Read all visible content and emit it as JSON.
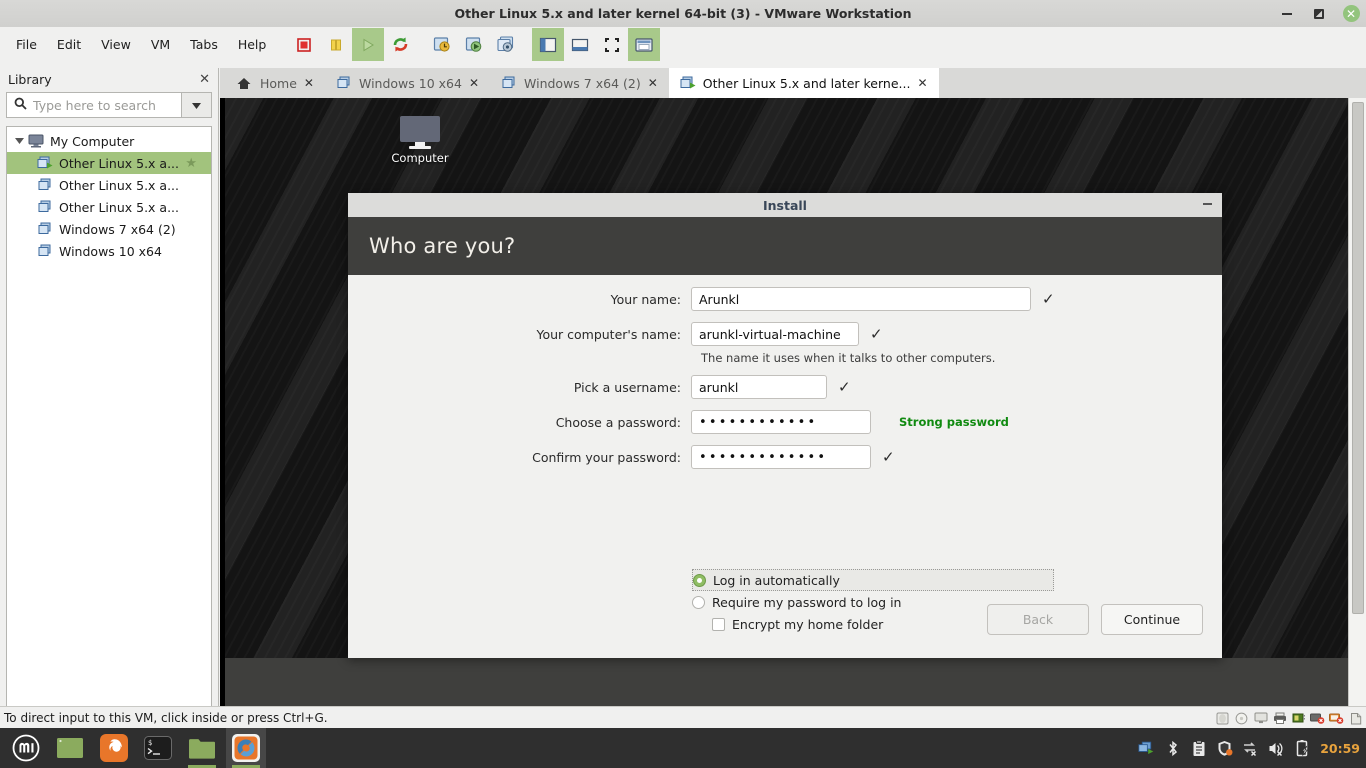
{
  "window": {
    "title": "Other Linux 5.x and later kernel 64-bit (3) - VMware Workstation",
    "minimize_icon": "minimize-icon",
    "maximize_icon": "restore-icon",
    "close_icon": "close-icon"
  },
  "menubar": {
    "items": [
      {
        "label": "File"
      },
      {
        "label": "Edit"
      },
      {
        "label": "View"
      },
      {
        "label": "VM"
      },
      {
        "label": "Tabs"
      },
      {
        "label": "Help"
      }
    ]
  },
  "toolbar": {
    "buttons": [
      {
        "name": "power-off-icon",
        "title": "Power Off"
      },
      {
        "name": "suspend-icon",
        "title": "Suspend"
      },
      {
        "name": "power-on-icon",
        "title": "Power On",
        "active": true
      },
      {
        "name": "restart-guest-icon",
        "title": "Restart Guest"
      },
      {
        "name": "snapshot-take-icon",
        "title": "Take Snapshot"
      },
      {
        "name": "snapshot-revert-icon",
        "title": "Revert Snapshot"
      },
      {
        "name": "snapshot-manager-icon",
        "title": "Manage Snapshots"
      },
      {
        "name": "show-library-icon",
        "title": "Show or hide the Library",
        "active": true
      },
      {
        "name": "show-thumbnails-icon",
        "title": "Show or hide thumbnail bar"
      },
      {
        "name": "fullscreen-icon",
        "title": "Enter full screen mode"
      },
      {
        "name": "unity-mode-icon",
        "title": "Unity mode",
        "active": true
      }
    ]
  },
  "library": {
    "title": "Library",
    "close_icon": "close-icon",
    "search": {
      "placeholder": "Type here to search",
      "value": "",
      "icon": "search-icon",
      "dropdown_icon": "chevron-down-icon"
    },
    "tree": [
      {
        "label": "My Computer",
        "icon": "computer-icon",
        "level": 0,
        "expanded": true,
        "selected": false
      },
      {
        "label": "Other Linux 5.x a...",
        "icon": "vm-running-icon",
        "level": 1,
        "selected": true,
        "favorite": true
      },
      {
        "label": "Other Linux 5.x a...",
        "icon": "vm-icon",
        "level": 1,
        "selected": false
      },
      {
        "label": "Other Linux 5.x a...",
        "icon": "vm-icon",
        "level": 1,
        "selected": false
      },
      {
        "label": "Windows 7 x64 (2)",
        "icon": "vm-icon",
        "level": 1,
        "selected": false
      },
      {
        "label": "Windows 10 x64",
        "icon": "vm-icon",
        "level": 1,
        "selected": false
      }
    ]
  },
  "tabs": [
    {
      "label": "Home",
      "icon": "home-icon",
      "active": false,
      "close_icon": "close-icon"
    },
    {
      "label": "Windows 10 x64",
      "icon": "vm-icon",
      "active": false,
      "close_icon": "close-icon"
    },
    {
      "label": "Windows 7 x64 (2)",
      "icon": "vm-icon",
      "active": false,
      "close_icon": "close-icon"
    },
    {
      "label": "Other Linux 5.x and later kerne...",
      "icon": "vm-running-icon",
      "active": true,
      "close_icon": "close-icon"
    }
  ],
  "guest": {
    "desktop_icon": {
      "label": "Computer",
      "icon": "computer-monitor-icon"
    },
    "installer": {
      "window_title": "Install",
      "minimize_icon": "minimize-icon",
      "heading": "Who are you?",
      "fields": [
        {
          "key": "your_name",
          "label": "Your name:",
          "value": "Arunkl",
          "valid_icon": "check-icon"
        },
        {
          "key": "computer_name",
          "label": "Your computer's name:",
          "value": "arunkl-virtual-machine",
          "valid_icon": "check-icon",
          "hint": "The name it uses when it talks to other computers."
        },
        {
          "key": "username",
          "label": "Pick a username:",
          "value": "arunkl",
          "valid_icon": "check-icon"
        },
        {
          "key": "password",
          "label": "Choose a password:",
          "value": "••••••••••••",
          "strength": "Strong password"
        },
        {
          "key": "confirm_password",
          "label": "Confirm your password:",
          "value": "•••••••••••••",
          "valid_icon": "check-icon"
        }
      ],
      "options": {
        "login_automatically": {
          "label": "Log in automatically",
          "selected": true
        },
        "require_password": {
          "label": "Require my password to log in",
          "selected": false
        },
        "encrypt_home": {
          "label": "Encrypt my home folder",
          "checked": false
        }
      },
      "buttons": {
        "back": {
          "label": "Back",
          "disabled": true
        },
        "continue": {
          "label": "Continue",
          "disabled": false
        }
      }
    },
    "taskbar": {
      "apps": [
        {
          "name": "mint-menu-icon",
          "label": "Menu"
        },
        {
          "name": "show-desktop-icon",
          "label": "Show Desktop"
        },
        {
          "name": "firefox-icon",
          "label": "Firefox Web Browser"
        },
        {
          "name": "terminal-icon",
          "label": "Terminal"
        },
        {
          "name": "files-icon",
          "label": "Files",
          "open": true
        },
        {
          "name": "ubuntu-installer-icon",
          "label": "Install",
          "running": true
        }
      ],
      "tray": [
        {
          "name": "workspace-switcher-icon"
        },
        {
          "name": "bluetooth-icon"
        },
        {
          "name": "clipboard-icon"
        },
        {
          "name": "update-shield-icon"
        },
        {
          "name": "network-disconnected-icon"
        },
        {
          "name": "volume-muted-icon"
        },
        {
          "name": "battery-charging-icon"
        }
      ],
      "clock": "20:59"
    }
  },
  "statusbar": {
    "message": "To direct input to this VM, click inside or press Ctrl+G.",
    "devices": [
      {
        "name": "hard-disk-icon"
      },
      {
        "name": "cd-dvd-icon"
      },
      {
        "name": "display-icon"
      },
      {
        "name": "printer-icon"
      },
      {
        "name": "network-adapter-icon"
      },
      {
        "name": "usb-disconnected-icon"
      },
      {
        "name": "sound-disconnected-icon"
      },
      {
        "name": "drag-handle-icon"
      }
    ]
  },
  "scrollbar": {
    "name": "vm-vertical-scrollbar"
  },
  "colors": {
    "accent_green": "#8fbd63",
    "selection_green": "#a2c37d",
    "strong_password": "#108a10",
    "clock_orange": "#e8a33d",
    "dialog_header": "#3f3f3d"
  }
}
